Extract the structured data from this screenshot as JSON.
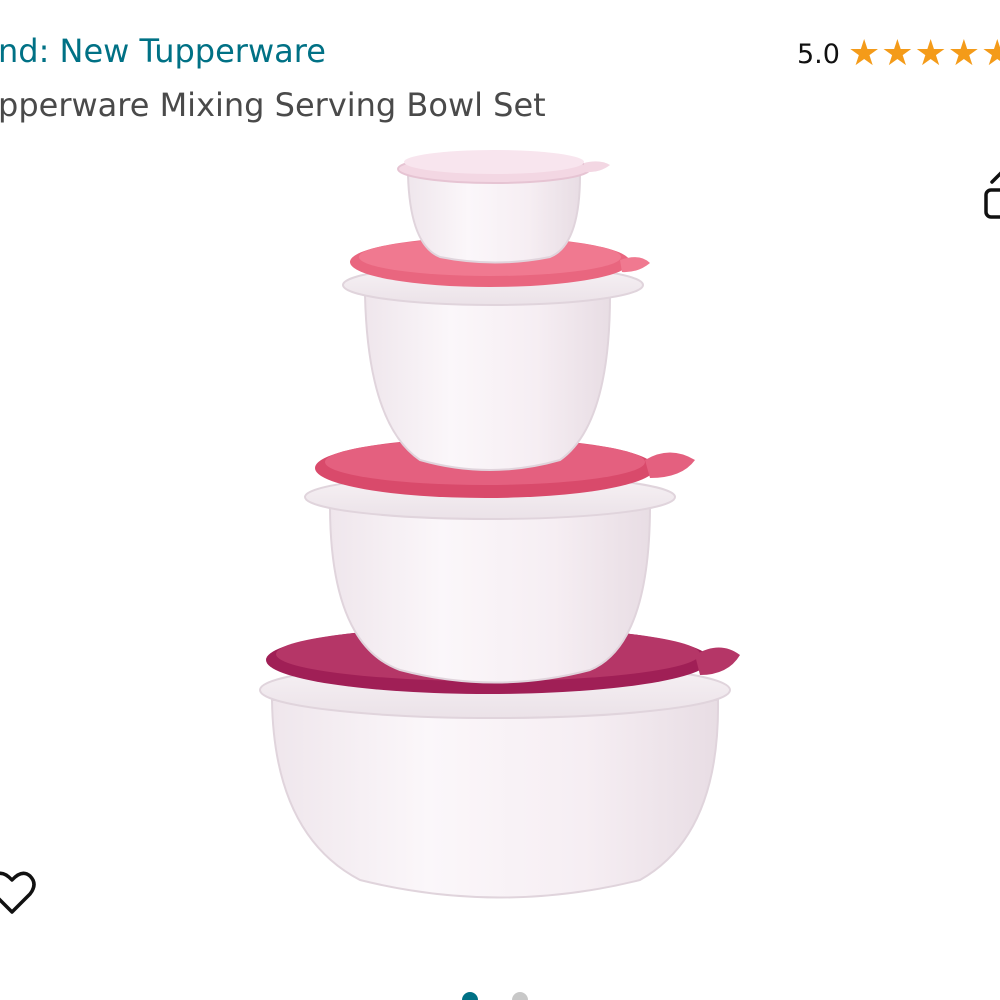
{
  "header": {
    "brand_link": "nd: New Tupperware",
    "product_title": "pperware Mixing Serving Bowl Set"
  },
  "rating": {
    "value": "5.0",
    "stars": 5,
    "star_color": "#f49b19"
  },
  "icons": {
    "share": "share-icon",
    "wishlist": "heart-icon"
  },
  "colors": {
    "link": "#007185",
    "title": "#4a4a4a",
    "lid_top": "#f3d7e3",
    "lid_second": "#e9667f",
    "lid_third": "#d94a6b",
    "lid_bottom": "#a01f56"
  },
  "carousel": {
    "total": 2,
    "active_index": 0
  }
}
